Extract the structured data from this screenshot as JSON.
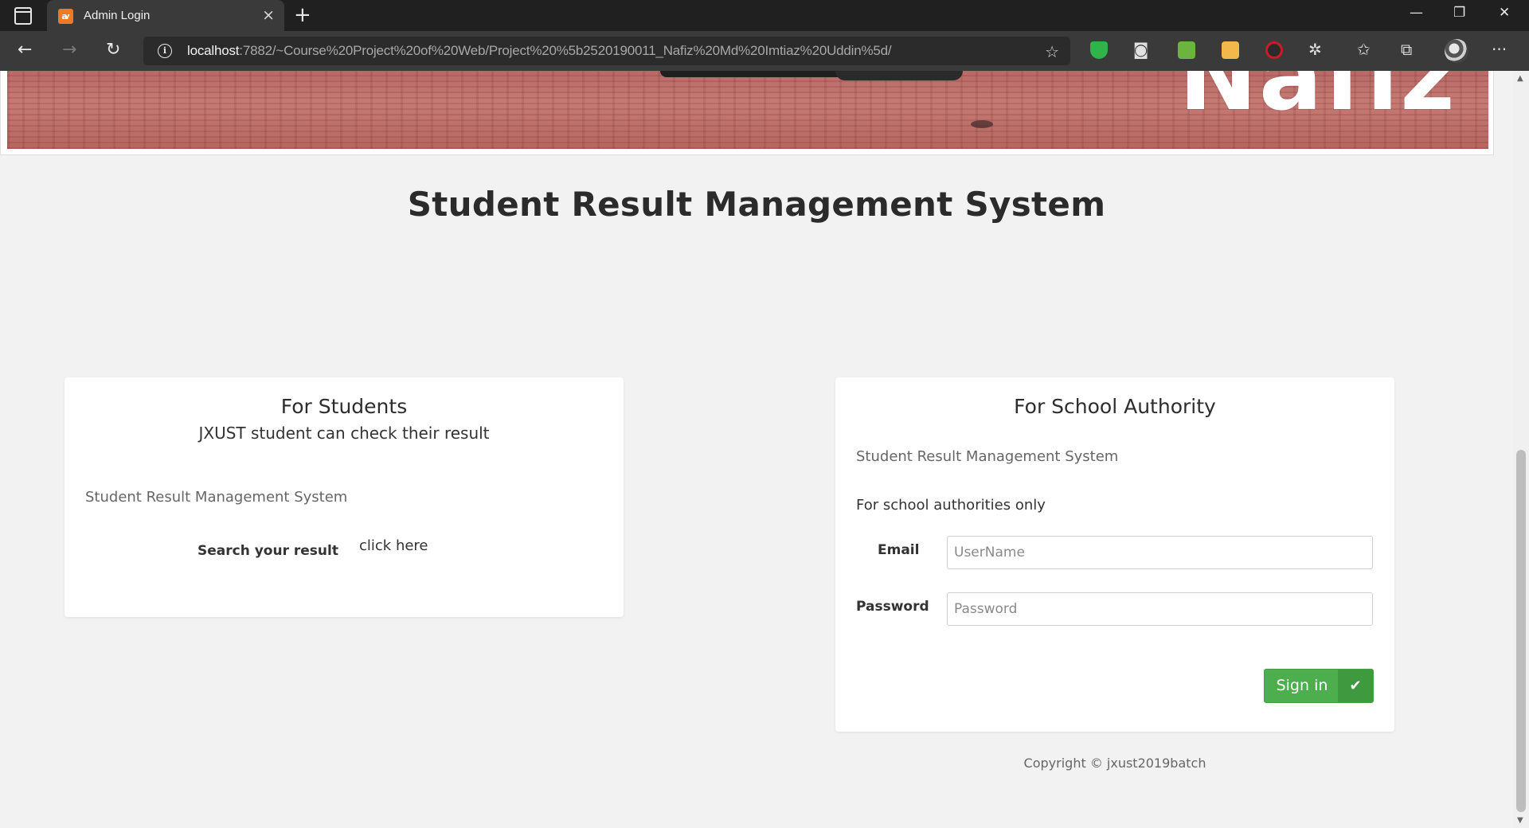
{
  "browser": {
    "tab_title": "Admin Login",
    "tab_close": "×",
    "new_tab": "+",
    "url_host": "localhost",
    "url_rest": ":7882/~Course%20Project%20of%20Web/Project%20%5b2520190011_Nafiz%20Md%20Imtiaz%20Uddin%5d/",
    "window_controls": {
      "minimize": "—",
      "restore": "❐",
      "close": "✕"
    },
    "nav": {
      "back": "←",
      "forward": "→",
      "reload": "↻"
    },
    "icons": [
      "info-icon",
      "add-favorite-icon",
      "shield-extension-icon",
      "camera-extension-icon",
      "download-extension-icon",
      "notes-extension-icon",
      "record-extension-icon",
      "extensions-icon",
      "favorites-icon",
      "collections-icon",
      "profile-icon",
      "more-icon"
    ],
    "more": "···"
  },
  "banner": {
    "logo_text": "Nafiz"
  },
  "page": {
    "title": "Student Result Management System"
  },
  "students_card": {
    "heading": "For Students",
    "subheading": "JXUST student can check their result",
    "system_name": "Student Result Management System",
    "search_label": "Search your result",
    "link": "click here"
  },
  "authority_card": {
    "heading": "For School Authority",
    "system_name": "Student Result Management System",
    "note": "For school authorities only",
    "email_label": "Email",
    "email_placeholder": "UserName",
    "password_label": "Password",
    "password_placeholder": "Password",
    "signin_label": "Sign in",
    "signin_icon": "✔"
  },
  "footer": {
    "copyright": "Copyright © jxust2019batch"
  },
  "colors": {
    "signin": "#4cae4c",
    "tabbar": "#202020",
    "toolbar": "#3a3a3a",
    "page_bg": "#f3f2f2"
  }
}
